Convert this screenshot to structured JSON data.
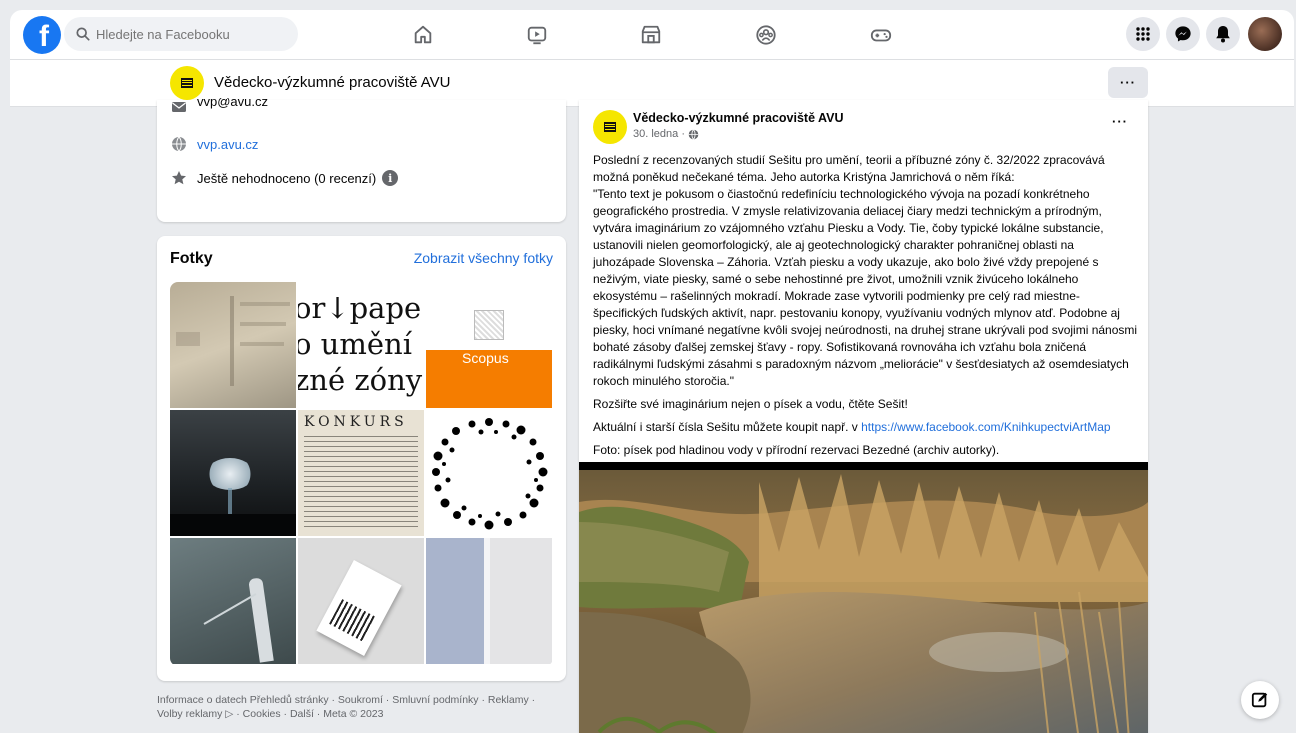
{
  "topbar": {
    "search_placeholder": "Hledejte na Facebooku",
    "nav_icons": [
      "home-icon",
      "watch-icon",
      "marketplace-icon",
      "groups-icon",
      "gaming-icon"
    ],
    "right_icons": [
      "menu-grid-icon",
      "messenger-icon",
      "notifications-icon",
      "account-avatar"
    ]
  },
  "page_header": {
    "name": "Vědecko-výzkumné pracoviště AVU",
    "more_label": "···"
  },
  "info": {
    "email": "vvp@avu.cz",
    "website": "vvp.avu.cz",
    "rating": "Ještě nehodnoceno (0 recenzí)"
  },
  "photos": {
    "title": "Fotky",
    "see_all": "Zobrazit všechny fotky",
    "tile2_lines": [
      "or↓pape",
      "o umění",
      "zné zóny"
    ],
    "tile3_brand": "Scopus",
    "tile5_title": "KONKURS"
  },
  "footer": {
    "line1": "Informace o datech Přehledů stránky · Soukromí · Smluvní podmínky · Reklamy ·",
    "line2": "Volby reklamy ▷ · Cookies · Další · Meta © 2023"
  },
  "post": {
    "author": "Vědecko-výzkumné pracoviště AVU",
    "date": "30. ledna ·",
    "more_label": "···",
    "paragraph1": "Poslední z recenzovaných studií Sešitu pro umění, teorii a příbuzné zóny č. 32/2022 zpracovává možná poněkud nečekané téma. Jeho autorka Kristýna Jamrichová o něm říká:",
    "paragraph2": "\"Tento text je pokusom o čiastočnú redefiníciu technologického vývoja na pozadí konkrétneho geografického prostredia. V zmysle relativizovania deliacej čiary medzi technickým a prírodným, vytvára imaginárium zo vzájomného vzťahu Piesku a Vody. Tie, čoby typické lokálne substancie, ustanovili nielen geomorfologický, ale aj geotechnologický charakter pohraničnej oblasti na juhozápade Slovenska – Záhoria. Vzťah piesku a vody ukazuje, ako bolo živé vždy prepojené s neživým, viate piesky, samé o sebe nehostinné pre život, umožnili vznik živúceho lokálneho ekosystému – rašelinných mokradí. Mokrade zase vytvorili podmienky pre celý rad miestne-špecifických ľudských aktivít, napr. pestovaniu konopy, využívaniu vodných mlynov atď. Podobne aj piesky, hoci vnímané negatívne kvôli svojej neúrodnosti, na druhej strane ukrývali pod svojimi nánosmi bohaté zásoby ďalšej zemskej šťavy - ropy. Sofistikovaná rovnováha ich vzťahu bola zničená radikálnymi ľudskými zásahmi s paradoxným názvom „meliorácie\" v šesťdesiatych až osemdesiatych rokoch minulého storočia.\"",
    "paragraph3": "Rozšiřte své imaginárium nejen o písek a vodu, čtěte Sešit!",
    "paragraph4_prefix": "Aktuální i starší čísla Sešitu můžete koupit např. v ",
    "paragraph4_link": "https://www.facebook.com/KnihkupectviArtMap",
    "paragraph5": "Foto: písek pod hladinou vody v přírodní rezervaci Bezedné (archiv autorky)."
  },
  "colors": {
    "facebook_blue": "#1877f2",
    "link_blue": "#216fdb",
    "avu_yellow": "#f5e600",
    "scopus_orange": "#f57d00"
  }
}
